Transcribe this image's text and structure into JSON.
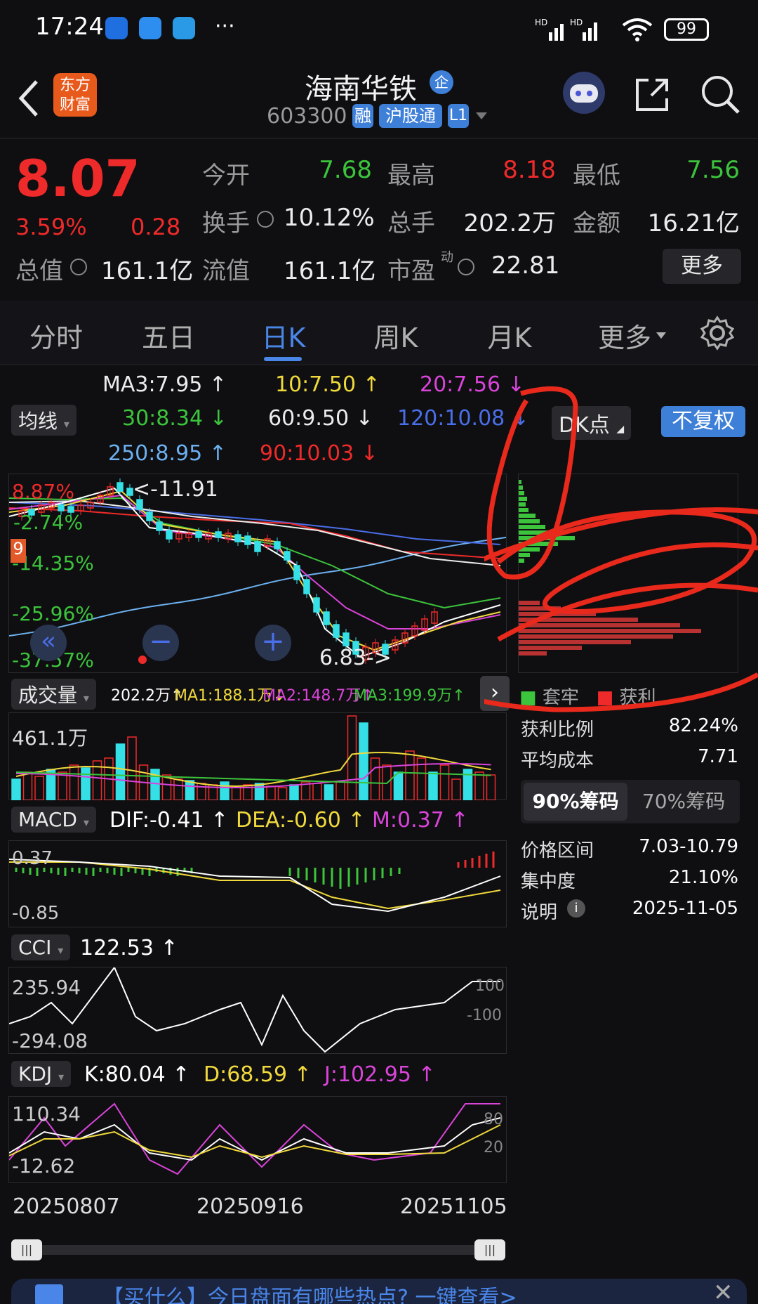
{
  "status_bar": {
    "time": "17:24",
    "more": "···",
    "signal1": "HD",
    "signal2": "HD",
    "battery": "99"
  },
  "header": {
    "app_logo": "东方财富",
    "stock_name": "海南华铁",
    "badge": "企",
    "code": "603300",
    "tags": [
      "融",
      "沪股通",
      "L1"
    ]
  },
  "quote": {
    "price": "8.07",
    "change_pct": "3.59%",
    "change": "0.28",
    "row1": [
      [
        "今开",
        "7.68"
      ],
      [
        "最高",
        "8.18"
      ],
      [
        "最低",
        "7.56"
      ]
    ],
    "row2": [
      [
        "换手",
        "10.12%"
      ],
      [
        "总手",
        "202.2万"
      ],
      [
        "金额",
        "16.21亿"
      ]
    ],
    "row3": [
      [
        "总值",
        "161.1亿"
      ],
      [
        "流值",
        "161.1亿"
      ],
      [
        "市盈",
        "22.81"
      ]
    ],
    "pe_super": "动",
    "more_button": "更多"
  },
  "tabs": [
    "分时",
    "五日",
    "日K",
    "周K",
    "月K",
    "更多"
  ],
  "ma": {
    "selector": "均线",
    "items": [
      {
        "label": "MA3:7.95 ↑",
        "color": "#ececec"
      },
      {
        "label": "10:7.50 ↑",
        "color": "#f0d93c"
      },
      {
        "label": "20:7.56 ↓",
        "color": "#d944d9"
      },
      {
        "label": "30:8.34 ↓",
        "color": "#3cc43c"
      },
      {
        "label": "60:9.50 ↓",
        "color": "#ececec"
      },
      {
        "label": "120:10.08 ↓",
        "color": "#4a6ee8"
      },
      {
        "label": "250:8.95 ↑",
        "color": "#6cb0f0"
      },
      {
        "label": "90:10.03 ↓",
        "color": "#ef2a2a"
      }
    ],
    "dk_button": "DK点",
    "adjust_button": "不复权"
  },
  "kline": {
    "pct_labels": [
      "8.87%",
      "-2.74%",
      "-14.35%",
      "-25.96%",
      "-37.57%"
    ],
    "high_label": "<-11.91",
    "low_label": "6.83->",
    "markers": [
      "9",
      "1",
      "2",
      "3",
      "4",
      "5",
      "6",
      "7",
      "8",
      "9",
      "2",
      "3",
      "4",
      "5"
    ]
  },
  "chips": {
    "legend_trapped": "套牢",
    "legend_profit": "获利",
    "profit_ratio_label": "获利比例",
    "profit_ratio": "82.24%",
    "avg_cost_label": "平均成本",
    "avg_cost": "7.71",
    "tab90": "90%筹码",
    "tab70": "70%筹码",
    "range_label": "价格区间",
    "range": "7.03-10.79",
    "conc_label": "集中度",
    "conc": "21.10%",
    "note_label": "说明",
    "note_date": "2025-11-05"
  },
  "volume": {
    "selector": "成交量",
    "value": "202.2万↑",
    "ma1": "MA1:188.1万↓",
    "ma2": "MA2:148.7万↑",
    "ma3": "MA3:199.9万↑",
    "max_label": "461.1万"
  },
  "macd": {
    "selector": "MACD",
    "dif": "DIF:-0.41 ↑",
    "dea": "DEA:-0.60 ↑",
    "m": "M:0.37 ↑",
    "top": "0.37",
    "bottom": "-0.85"
  },
  "cci": {
    "selector": "CCI",
    "value": "122.53 ↑",
    "top": "235.94",
    "bottom": "-294.08",
    "ref1": "100",
    "ref2": "-100"
  },
  "kdj": {
    "selector": "KDJ",
    "k": "K:80.04 ↑",
    "d": "D:68.59 ↑",
    "j": "J:102.95 ↑",
    "top": "110.34",
    "bottom": "-12.62",
    "ref1": "80",
    "ref2": "20"
  },
  "dates": [
    "20250807",
    "20250916",
    "20251105"
  ],
  "bottom_banner": "【买什么】今日盘面有哪些热点? 一键查看>"
}
